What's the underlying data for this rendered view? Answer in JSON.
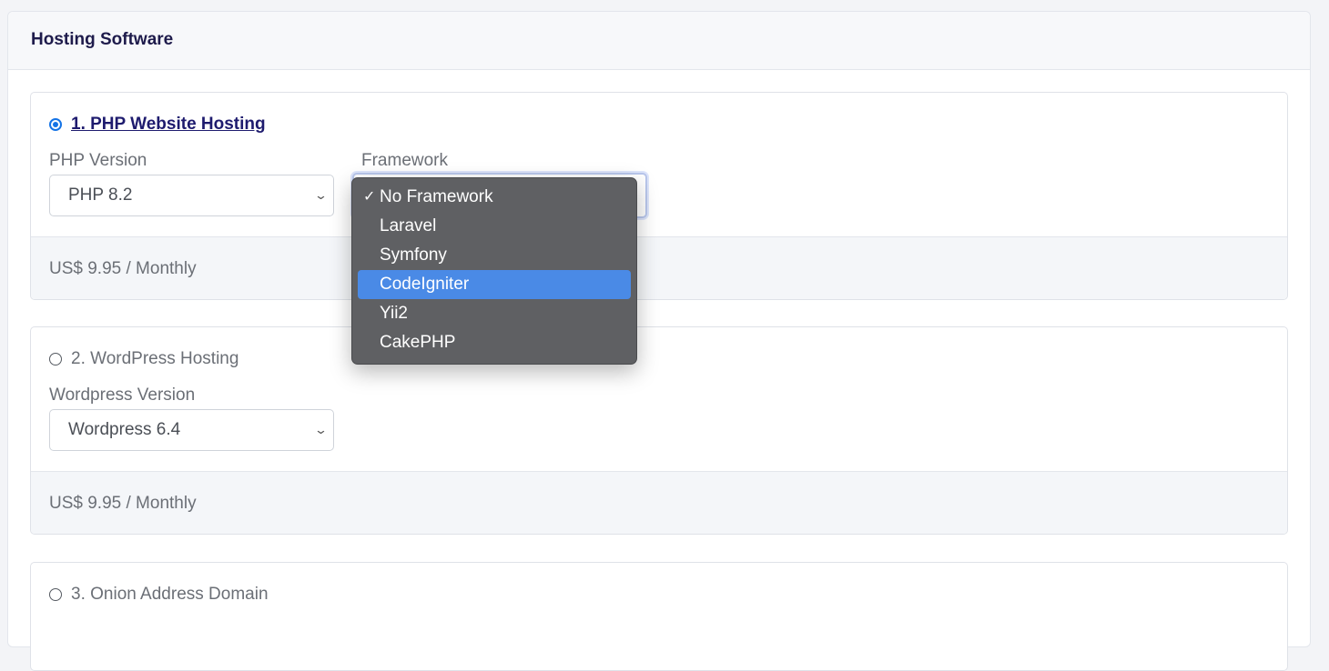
{
  "card": {
    "title": "Hosting Software"
  },
  "options": [
    {
      "number_title": "1. PHP Website Hosting",
      "selected": true,
      "fields": [
        {
          "label": "PHP Version",
          "value": "PHP 8.2"
        },
        {
          "label": "Framework",
          "value": "No Framework"
        }
      ],
      "price": "US$ 9.95 / Monthly"
    },
    {
      "number_title": "2. WordPress Hosting",
      "selected": false,
      "fields": [
        {
          "label": "Wordpress Version",
          "value": "Wordpress 6.4"
        }
      ],
      "price": "US$ 9.95 / Monthly"
    },
    {
      "number_title": "3. Onion Address Domain",
      "selected": false
    }
  ],
  "framework_dropdown": {
    "checked": "No Framework",
    "highlighted": "CodeIgniter",
    "items": [
      "No Framework",
      "Laravel",
      "Symfony",
      "CodeIgniter",
      "Yii2",
      "CakePHP"
    ],
    "check_glyph": "✓"
  },
  "icons": {
    "chevron": "chevron-down-icon",
    "check": "checkmark-icon"
  },
  "colors": {
    "accent": "#1473e6",
    "title": "#1e1b4b",
    "highlight": "#4a8ae6",
    "dropdown_bg": "#5f6063"
  }
}
